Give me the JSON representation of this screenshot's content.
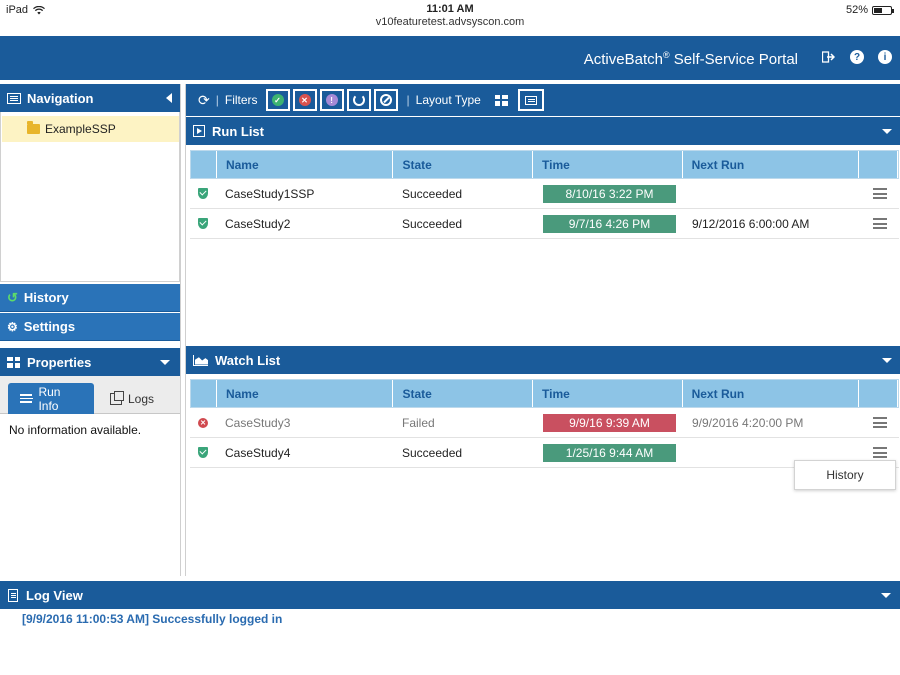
{
  "status_bar": {
    "device": "iPad",
    "clock": "11:01 AM",
    "battery": "52%",
    "url": "v10featuretest.advsyscon.com"
  },
  "header": {
    "title": "ActiveBatch",
    "title_reg": "®",
    "title_suffix": " Self-Service Portal"
  },
  "navigation": {
    "title": "Navigation",
    "items": [
      {
        "label": "ExampleSSP"
      }
    ]
  },
  "sidebar": {
    "history": "History",
    "settings": "Settings"
  },
  "properties": {
    "title": "Properties",
    "tabs": [
      {
        "label": "Run Info"
      },
      {
        "label": "Logs"
      }
    ],
    "body": "No information available."
  },
  "toolbar": {
    "filters_label": "Filters",
    "layout_label": "Layout Type",
    "sep": "|"
  },
  "run_list": {
    "title": "Run List",
    "columns": [
      "Name",
      "State",
      "Time",
      "Next Run"
    ],
    "rows": [
      {
        "name": "CaseStudy1SSP",
        "state": "Succeeded",
        "time": "8/10/16 3:22 PM",
        "next_run": ""
      },
      {
        "name": "CaseStudy2",
        "state": "Succeeded",
        "time": "9/7/16 4:26 PM",
        "next_run": "9/12/2016 6:00:00 AM"
      }
    ]
  },
  "watch_list": {
    "title": "Watch List",
    "columns": [
      "Name",
      "State",
      "Time",
      "Next Run"
    ],
    "rows": [
      {
        "name": "CaseStudy3",
        "state": "Failed",
        "time": "9/9/16 9:39 AM",
        "next_run": "9/9/2016 4:20:00 PM"
      },
      {
        "name": "CaseStudy4",
        "state": "Succeeded",
        "time": "1/25/16 9:44 AM",
        "next_run": ""
      }
    ]
  },
  "context_menu": {
    "item": "History"
  },
  "log_view": {
    "title": "Log View",
    "entry": "[9/9/2016 11:00:53 AM] Successfully logged in"
  },
  "colors": {
    "brand": "#1a5b9a",
    "accent": "#2a73b8",
    "success": "#4a9a7c",
    "failure": "#c95060",
    "grid_header": "#8dc4e6"
  }
}
